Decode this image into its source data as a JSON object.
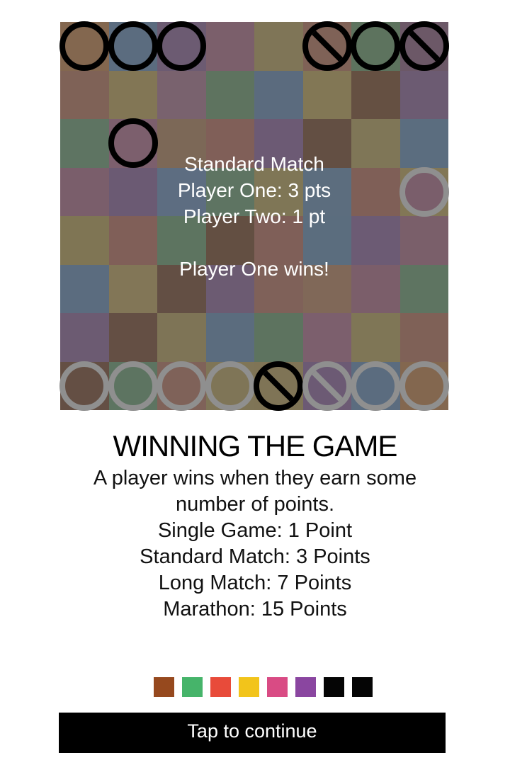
{
  "game": {
    "board_size": 8,
    "cell_colors": [
      [
        "#83674f",
        "#5b6c7f",
        "#6c5b72",
        "#7b5f6b",
        "#7f7557",
        "#7f6257",
        "#5d735e",
        "#6c5867"
      ],
      [
        "#7f6257",
        "#827655",
        "#79626e",
        "#5e735f",
        "#5b6b7e",
        "#827755",
        "#655042",
        "#6c5b72"
      ],
      [
        "#5e7462",
        "#7c5f6d",
        "#7c6857",
        "#805f58",
        "#6c5a74",
        "#634f43",
        "#7f7657",
        "#5b6d7f"
      ],
      [
        "#7a5e6b",
        "#6b5a73",
        "#5d6d81",
        "#5e7462",
        "#7f7656",
        "#5c6d7e",
        "#7f5f57",
        "#827756"
      ],
      [
        "#7f7554",
        "#805f58",
        "#5d7460",
        "#634f42",
        "#7f5f58",
        "#5b6d7e",
        "#6c5b74",
        "#7a5f6a"
      ],
      [
        "#5b6c7f",
        "#827657",
        "#634f44",
        "#6c5b72",
        "#7f6159",
        "#806858",
        "#7b5e6a",
        "#5e7461"
      ],
      [
        "#6c5b72",
        "#644f44",
        "#7e7456",
        "#5b6c7e",
        "#5d735f",
        "#7c5f6d",
        "#7f7656",
        "#7f6157"
      ],
      [
        "#644f44",
        "#5d7461",
        "#7f6259",
        "#7f7557",
        "#7f7456",
        "#6c5a74",
        "#5b6c7f",
        "#83674f"
      ]
    ],
    "pieces": [
      {
        "row": 0,
        "col": 0,
        "side": "black",
        "marked": false,
        "fill": "#83674f",
        "icon": "ring-piece-icon"
      },
      {
        "row": 0,
        "col": 1,
        "side": "black",
        "marked": false,
        "fill": "#5b6c7f",
        "icon": "ring-piece-icon"
      },
      {
        "row": 0,
        "col": 2,
        "side": "black",
        "marked": false,
        "fill": "#6c5b72",
        "icon": "ring-piece-icon"
      },
      {
        "row": 0,
        "col": 5,
        "side": "black",
        "marked": true,
        "fill": "#7f6257",
        "icon": "slashed-piece-icon"
      },
      {
        "row": 0,
        "col": 6,
        "side": "black",
        "marked": false,
        "fill": "#5d735e",
        "icon": "ring-piece-icon"
      },
      {
        "row": 0,
        "col": 7,
        "side": "black",
        "marked": true,
        "fill": "#6c5867",
        "icon": "slashed-piece-icon"
      },
      {
        "row": 2,
        "col": 1,
        "side": "black",
        "marked": false,
        "fill": "#7c5f6d",
        "icon": "ring-piece-icon"
      },
      {
        "row": 3,
        "col": 7,
        "side": "grey",
        "marked": false,
        "fill": "#7a5e6b",
        "icon": "ring-piece-icon"
      },
      {
        "row": 7,
        "col": 0,
        "side": "grey",
        "marked": false,
        "fill": "#644f44",
        "icon": "ring-piece-icon"
      },
      {
        "row": 7,
        "col": 1,
        "side": "grey",
        "marked": false,
        "fill": "#5d7461",
        "icon": "ring-piece-icon"
      },
      {
        "row": 7,
        "col": 2,
        "side": "grey",
        "marked": false,
        "fill": "#7f6259",
        "icon": "ring-piece-icon"
      },
      {
        "row": 7,
        "col": 3,
        "side": "grey",
        "marked": false,
        "fill": "#7f7557",
        "icon": "ring-piece-icon"
      },
      {
        "row": 7,
        "col": 4,
        "side": "black",
        "marked": true,
        "fill": "#7f7456",
        "icon": "slashed-piece-icon"
      },
      {
        "row": 7,
        "col": 5,
        "side": "grey",
        "marked": true,
        "fill": "#6c5a74",
        "icon": "slashed-piece-icon"
      },
      {
        "row": 7,
        "col": 6,
        "side": "grey",
        "marked": false,
        "fill": "#5b6c7f",
        "icon": "ring-piece-icon"
      },
      {
        "row": 7,
        "col": 7,
        "side": "grey",
        "marked": false,
        "fill": "#83674f",
        "icon": "ring-piece-icon"
      }
    ],
    "overlay": {
      "mode": "Standard Match",
      "player_one": "Player One: 3 pts",
      "player_two": "Player Two: 1 pt",
      "result": "Player One wins!"
    }
  },
  "tutorial": {
    "title": "WINNING THE GAME",
    "lines": [
      "A player wins when they earn some number of points.",
      "Single Game: 1 Point",
      "Standard Match: 3 Points",
      "Long Match: 7 Points",
      "Marathon: 15 Points"
    ]
  },
  "page_indicator": {
    "colors": [
      "#96491e",
      "#46b46a",
      "#e84b3a",
      "#f2c41b",
      "#d94b84",
      "#8a46a0",
      "#050505",
      "#050505"
    ]
  },
  "continue_button": {
    "label": "Tap to continue"
  }
}
